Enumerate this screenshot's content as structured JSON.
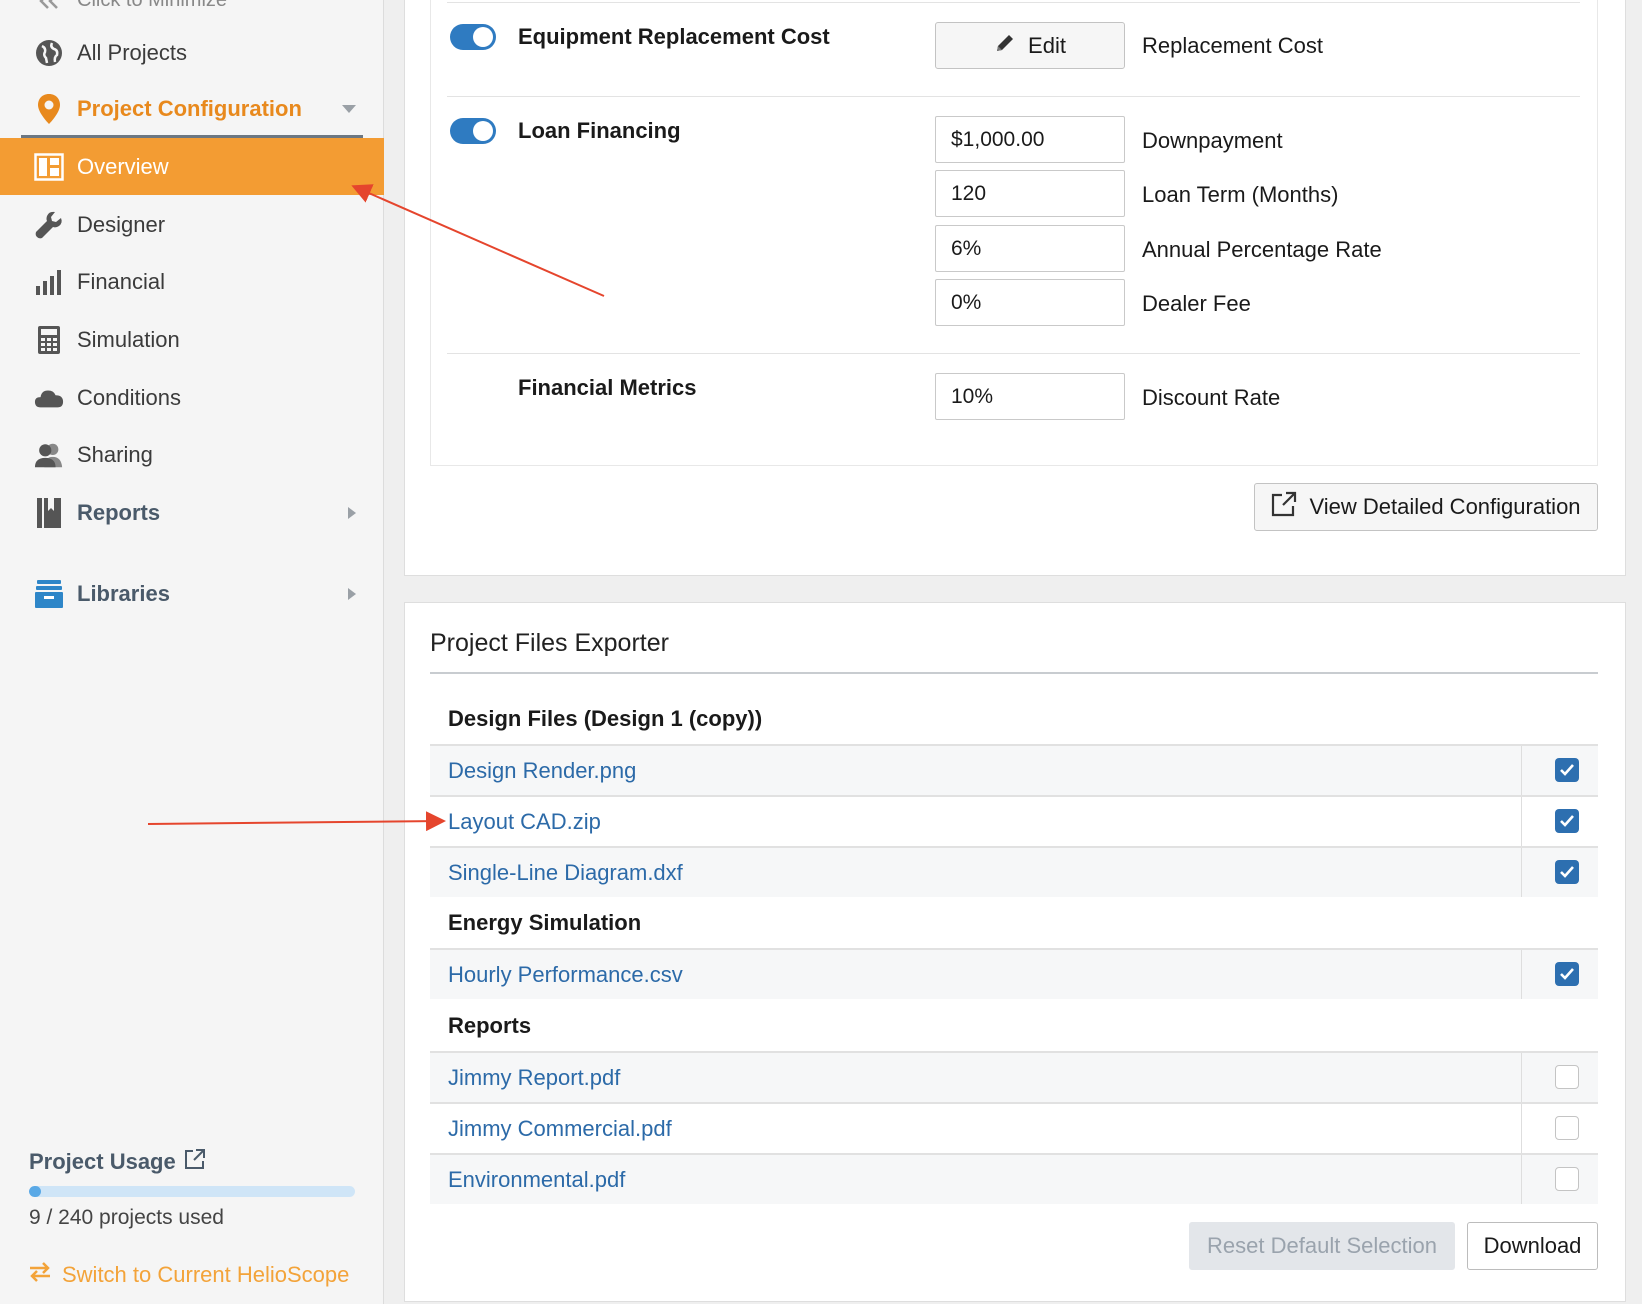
{
  "sidebar": {
    "minimize_label": "Click to Minimize",
    "items": [
      {
        "label": "All Projects",
        "icon": "globe-icon"
      },
      {
        "label": "Project Configuration",
        "icon": "map-pin-icon"
      },
      {
        "label": "Overview",
        "icon": "dashboard-icon"
      },
      {
        "label": "Designer",
        "icon": "wrench-icon"
      },
      {
        "label": "Financial",
        "icon": "bar-chart-icon"
      },
      {
        "label": "Simulation",
        "icon": "calculator-icon"
      },
      {
        "label": "Conditions",
        "icon": "cloud-icon"
      },
      {
        "label": "Sharing",
        "icon": "users-icon"
      },
      {
        "label": "Reports",
        "icon": "book-icon"
      },
      {
        "label": "Libraries",
        "icon": "archive-icon"
      }
    ],
    "usage": {
      "title": "Project Usage",
      "used": 9,
      "total": 240,
      "text": "9 / 240 projects used"
    },
    "switch_label": "Switch to Current HelioScope"
  },
  "config": {
    "equipment": {
      "title": "Equipment Replacement Cost",
      "enabled": true,
      "edit_label": "Edit",
      "field_label": "Replacement Cost"
    },
    "loan": {
      "title": "Loan Financing",
      "enabled": true,
      "fields": [
        {
          "value": "$1,000.00",
          "label": "Downpayment"
        },
        {
          "value": "120",
          "label": "Loan Term (Months)"
        },
        {
          "value": "6%",
          "label": "Annual Percentage Rate"
        },
        {
          "value": "0%",
          "label": "Dealer Fee"
        }
      ]
    },
    "metrics": {
      "title": "Financial Metrics",
      "fields": [
        {
          "value": "10%",
          "label": "Discount Rate"
        }
      ]
    },
    "view_detailed_label": "View Detailed Configuration"
  },
  "files": {
    "title": "Project Files Exporter",
    "groups": [
      {
        "title": "Design Files (Design 1 (copy))",
        "files": [
          {
            "name": "Design Render.png",
            "checked": true
          },
          {
            "name": "Layout CAD.zip",
            "checked": true
          },
          {
            "name": "Single-Line Diagram.dxf",
            "checked": true
          }
        ]
      },
      {
        "title": "Energy Simulation",
        "files": [
          {
            "name": "Hourly Performance.csv",
            "checked": true
          }
        ]
      },
      {
        "title": "Reports",
        "files": [
          {
            "name": "Jimmy Report.pdf",
            "checked": false
          },
          {
            "name": "Jimmy Commercial.pdf",
            "checked": false
          },
          {
            "name": "Environmental.pdf",
            "checked": false
          }
        ]
      }
    ],
    "reset_label": "Reset Default Selection",
    "download_label": "Download"
  },
  "colors": {
    "accent_orange": "#f39c33",
    "toggle_blue": "#2f7bc1",
    "link_blue": "#2c6aa8",
    "annotation_red": "#e5452d"
  }
}
